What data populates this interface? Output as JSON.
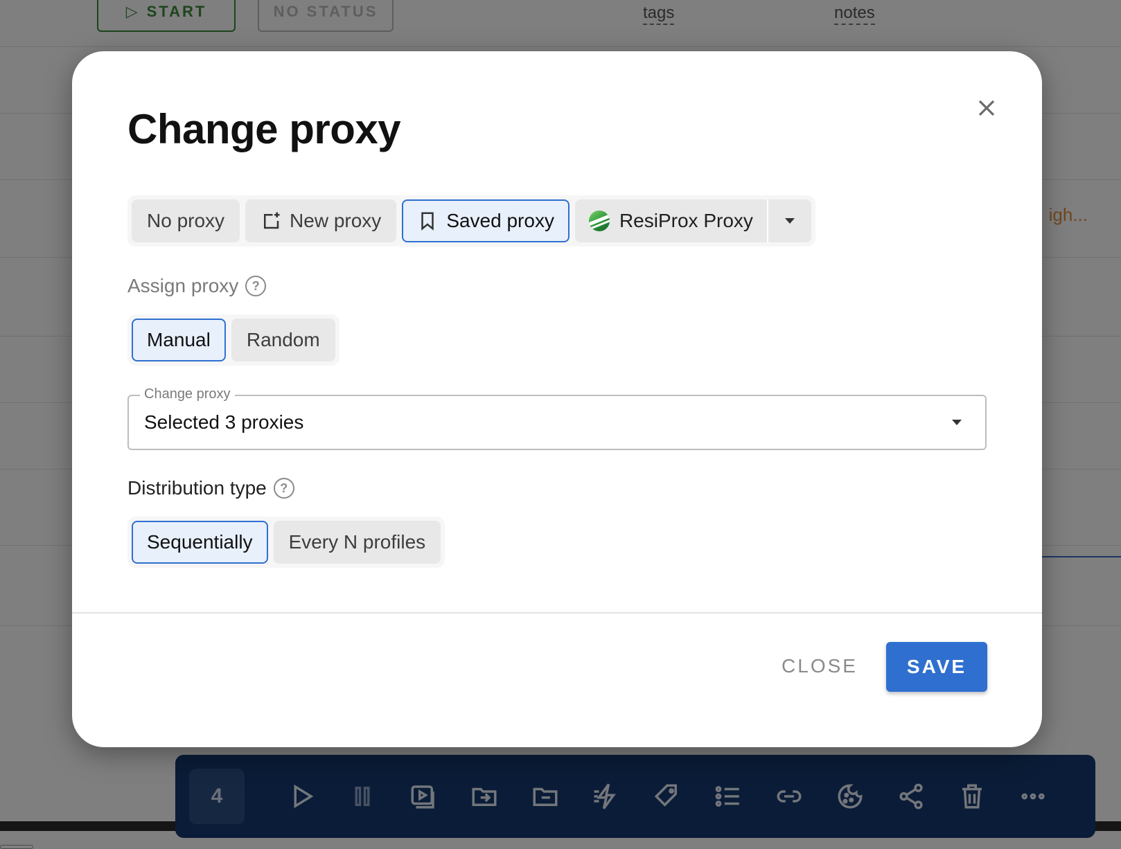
{
  "background": {
    "start_label": "START",
    "status_label": "NO STATUS",
    "tags_label": "tags",
    "notes_label": "notes",
    "truncated_text": "igh...",
    "selected_count": "4"
  },
  "dialog": {
    "title": "Change proxy",
    "proxy_modes": {
      "no_proxy": "No proxy",
      "new_proxy": "New proxy",
      "saved_proxy": "Saved proxy",
      "provider": "ResiProx Proxy",
      "selected": "Saved proxy"
    },
    "assign": {
      "label": "Assign proxy",
      "help": "?",
      "manual": "Manual",
      "random": "Random",
      "selected": "Manual"
    },
    "change_field": {
      "legend": "Change proxy",
      "value": "Selected 3 proxies"
    },
    "distribution": {
      "label": "Distribution type",
      "help": "?",
      "sequentially": "Sequentially",
      "every_n": "Every N profiles",
      "selected": "Sequentially"
    },
    "footer": {
      "close_label": "CLOSE",
      "save_label": "SAVE"
    }
  },
  "colors": {
    "accent": "#2f6fd0",
    "active_bg": "#e8f0fb",
    "toolbar_bg": "#15396e",
    "start_green": "#3a8a3a"
  },
  "icons": {
    "close": "close-icon",
    "new_proxy": "add-window-icon",
    "saved_proxy": "bookmark-icon",
    "dropdown": "caret-down-icon"
  }
}
